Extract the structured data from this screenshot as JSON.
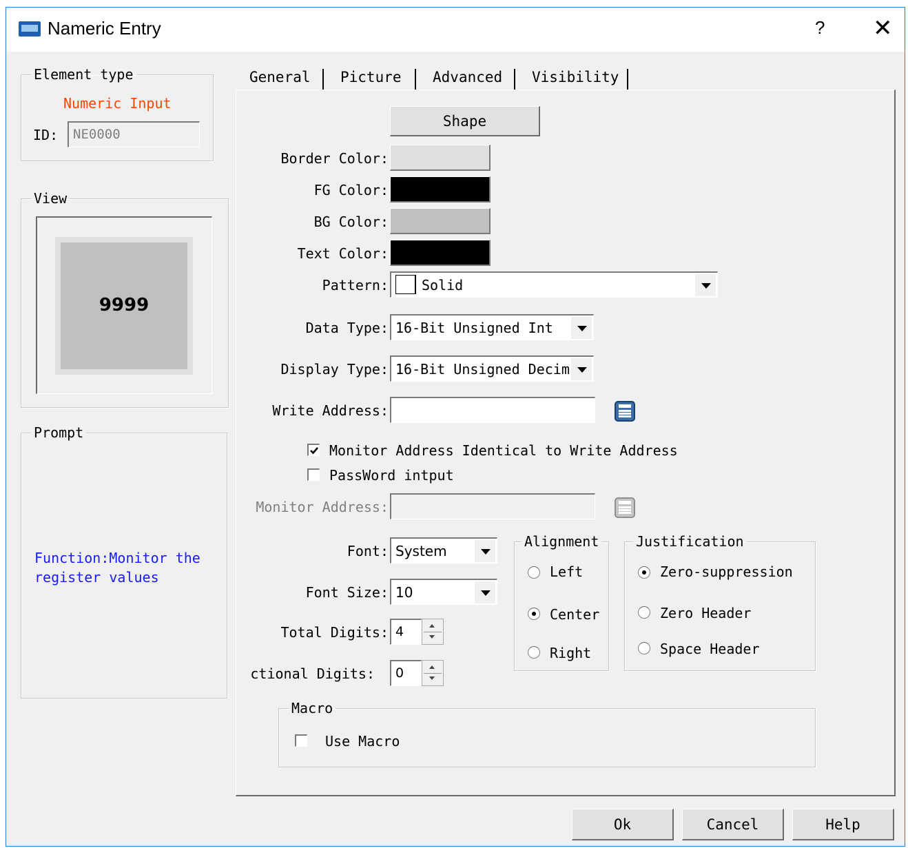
{
  "window": {
    "title": "Nameric Entry",
    "help": "?",
    "close": "✕"
  },
  "element_type": {
    "legend": "Element type",
    "type_name": "Numeric Input",
    "id_label": "ID:",
    "id_value": "NE0000"
  },
  "view": {
    "legend": "View",
    "preview_value": "9999"
  },
  "prompt": {
    "legend": "Prompt",
    "text_line1": "Function:Monitor the",
    "text_line2": "register values"
  },
  "tabs": [
    "General",
    "Picture",
    "Advanced",
    "Visibility"
  ],
  "general": {
    "shape_button": "Shape",
    "border_color_label": "Border Color:",
    "fg_color_label": "FG Color:",
    "bg_color_label": "BG Color:",
    "text_color_label": "Text Color:",
    "pattern_label": "Pattern:",
    "pattern_value": "Solid",
    "data_type_label": "Data Type:",
    "data_type_value": "16-Bit Unsigned Int",
    "display_type_label": "Display Type:",
    "display_type_value": "16-Bit Unsigned Decim",
    "write_address_label": "Write Address:",
    "write_address_value": "",
    "monitor_identical_label": "Monitor Address Identical to Write Address",
    "monitor_identical_checked": true,
    "password_label": "PassWord intput",
    "password_checked": false,
    "monitor_address_label": "Monitor Address:",
    "monitor_address_value": "",
    "font_label": "Font:",
    "font_value": "System",
    "font_size_label": "Font Size:",
    "font_size_value": "10",
    "total_digits_label": "Total Digits:",
    "total_digits_value": "4",
    "fractional_digits_label": "ctional Digits:",
    "fractional_digits_value": "0"
  },
  "alignment": {
    "legend": "Alignment",
    "options": [
      "Left",
      "Center",
      "Right"
    ],
    "selected": "Center"
  },
  "justification": {
    "legend": "Justification",
    "options": [
      "Zero-suppression",
      "Zero Header",
      "Space Header"
    ],
    "selected": "Zero-suppression"
  },
  "macro": {
    "legend": "Macro",
    "use_macro_label": "Use Macro",
    "use_macro_checked": false
  },
  "footer": {
    "ok": "Ok",
    "cancel": "Cancel",
    "help": "Help"
  },
  "colors": {
    "border_color": "#e0e0e0",
    "fg_color": "#000000",
    "bg_color": "#c0c0c0",
    "text_color": "#000000",
    "element_type_accent": "#ff4500",
    "prompt_text": "#1a1aff",
    "title_icon": "#1e5fb5"
  }
}
